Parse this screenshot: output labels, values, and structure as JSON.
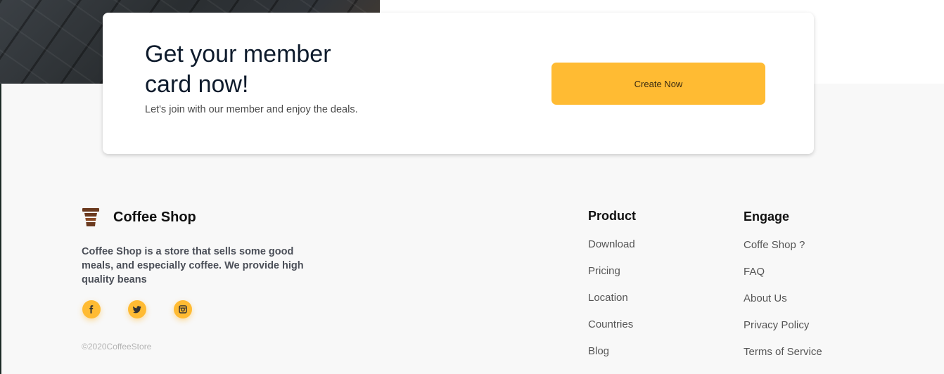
{
  "member_card": {
    "title": "Get your member card now!",
    "subtitle": "Let's join with our member and enjoy the deals.",
    "button_label": "Create Now"
  },
  "footer": {
    "brand_name": "Coffee Shop",
    "description": "Coffee Shop is a store that sells some good meals, and especially coffee. We provide high quality beans",
    "socials": [
      {
        "icon": "facebook-icon"
      },
      {
        "icon": "twitter-icon"
      },
      {
        "icon": "instagram-icon"
      }
    ],
    "copyright": "©2020CoffeeStore",
    "product": {
      "title": "Product",
      "links": [
        "Download",
        "Pricing",
        "Location",
        "Countries",
        "Blog"
      ]
    },
    "engage": {
      "title": "Engage",
      "links": [
        "Coffe Shop ?",
        "FAQ",
        "About Us",
        "Privacy Policy",
        "Terms of Service"
      ]
    }
  },
  "colors": {
    "accent": "#ffbb33",
    "page_background": "#f8f8f8",
    "heading": "#0e1b2c",
    "cup_brown": "#6b3a1f"
  }
}
